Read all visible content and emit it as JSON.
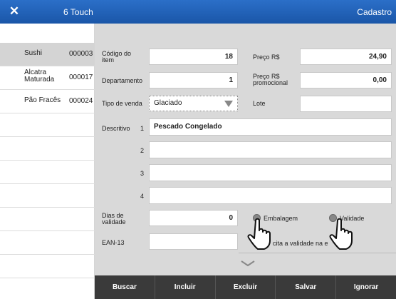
{
  "titlebar": {
    "close_glyph": "✕",
    "app_name": "6 Touch",
    "screen_title": "Cadastro"
  },
  "list": [
    {
      "name": "",
      "code": ""
    },
    {
      "name": "Sushi",
      "code": "000003",
      "selected": true
    },
    {
      "name": "Alcatra Maturada",
      "code": "000017"
    },
    {
      "name": "Pão Fracês",
      "code": "000024"
    },
    {
      "name": "",
      "code": ""
    },
    {
      "name": "",
      "code": ""
    },
    {
      "name": "",
      "code": ""
    },
    {
      "name": "",
      "code": ""
    },
    {
      "name": "",
      "code": ""
    },
    {
      "name": "",
      "code": ""
    },
    {
      "name": "",
      "code": ""
    },
    {
      "name": "",
      "code": ""
    }
  ],
  "form": {
    "codigo_label": "Código do item",
    "codigo_value": "18",
    "preco_label": "Preço R$",
    "preco_value": "24,90",
    "departamento_label": "Departamento",
    "departamento_value": "1",
    "preco_promo_label": "Preço R$ promocional",
    "preco_promo_value": "0,00",
    "tipo_venda_label": "Tipo de venda",
    "tipo_venda_value": "Glaciado",
    "lote_label": "Lote",
    "lote_value": "",
    "descritivo_label": "Descritivo",
    "desc_lines": [
      {
        "n": "1",
        "text": "Pescado Congelado"
      },
      {
        "n": "2",
        "text": ""
      },
      {
        "n": "3",
        "text": ""
      },
      {
        "n": "4",
        "text": ""
      }
    ],
    "dias_validade_label": "Dias de validade",
    "dias_validade_value": "0",
    "embalagem_label": "Embalagem",
    "validade_label": "Validade",
    "ean_label": "EAN-13",
    "ean_value": "",
    "partial_text": "cita a validade na e"
  },
  "buttons": {
    "buscar": "Buscar",
    "incluir": "Incluir",
    "excluir": "Excluir",
    "salvar": "Salvar",
    "ignorar": "Ignorar"
  },
  "colors": {
    "titlebar": "#1a56a8",
    "bottombar": "#3a3a3a",
    "form_bg": "#d9d9d9",
    "selected_row": "#d4d4d4"
  }
}
